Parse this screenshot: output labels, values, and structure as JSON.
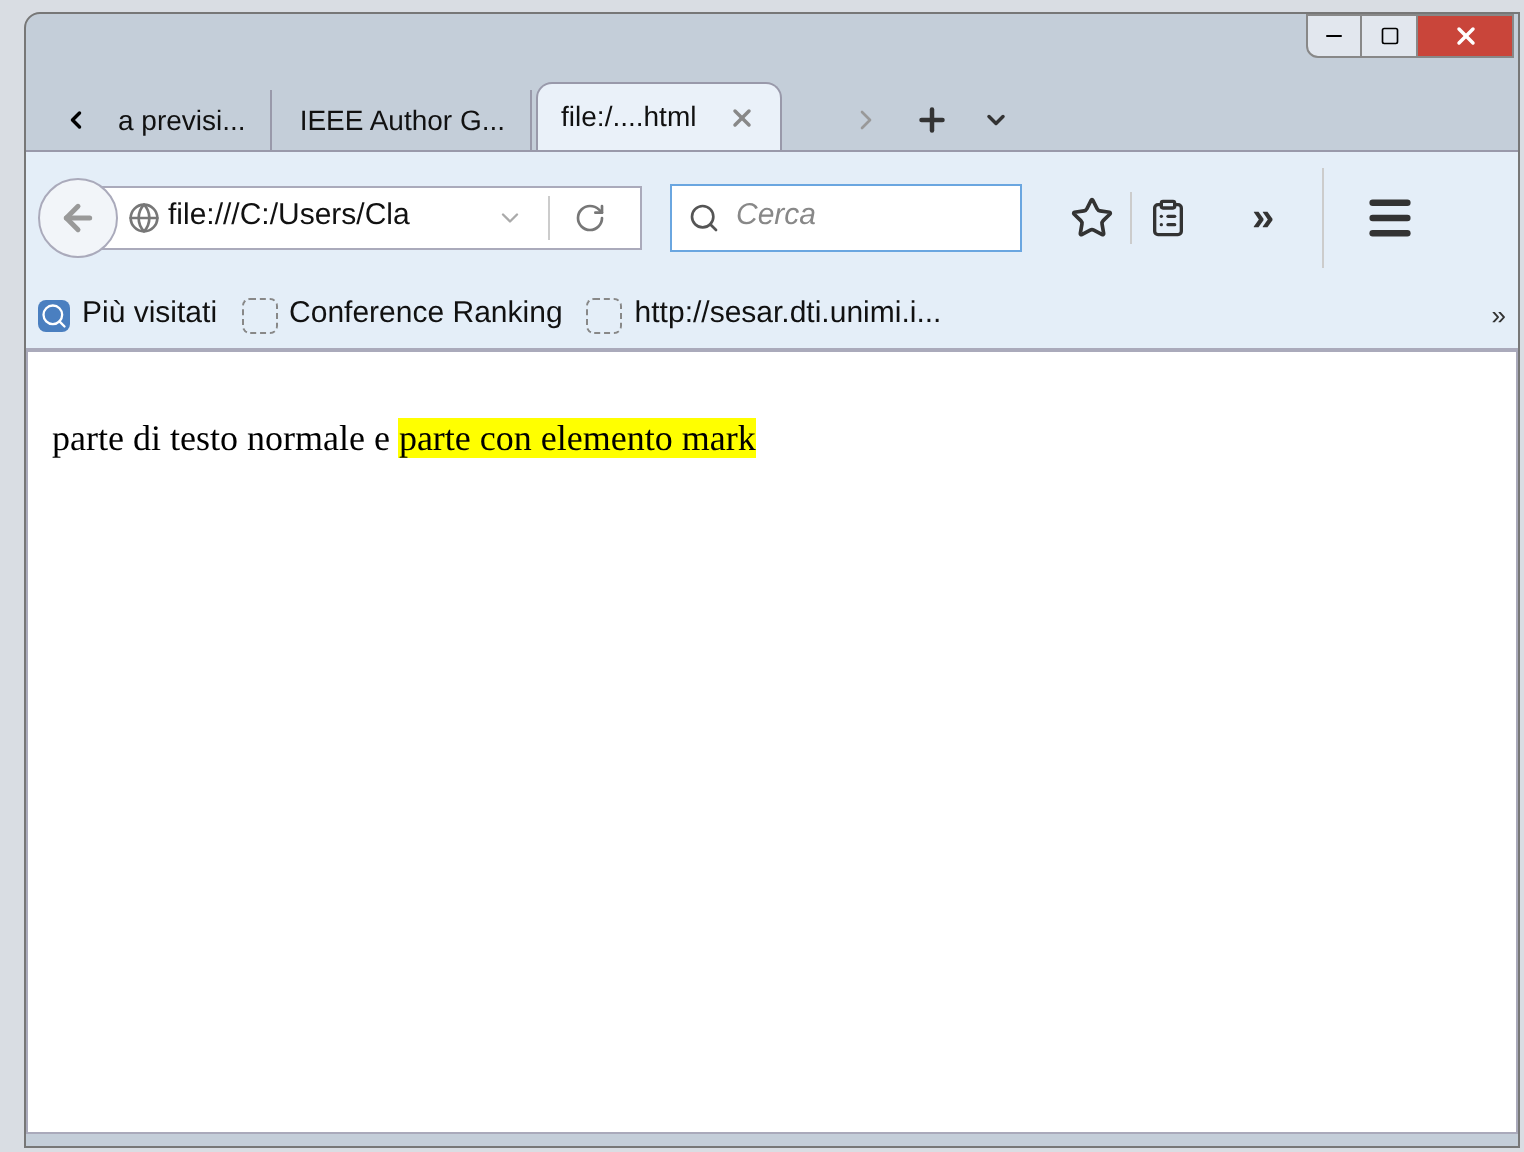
{
  "tabs": [
    {
      "label": "a previsi...",
      "selected": false
    },
    {
      "label": "IEEE Author G...",
      "selected": false
    },
    {
      "label": "file:/....html",
      "selected": true
    }
  ],
  "address_bar": {
    "value": "file:///C:/Users/Cla"
  },
  "search": {
    "placeholder": "Cerca"
  },
  "toolbar_overflow": "»",
  "bookmarks": [
    {
      "label": "Più visitati",
      "kind": "folder"
    },
    {
      "label": "Conference Ranking",
      "kind": "page"
    },
    {
      "label": "http://sesar.dti.unimi.i...",
      "kind": "page"
    }
  ],
  "bookmarks_overflow": "»",
  "content": {
    "segments": [
      {
        "text": "parte di testo normale e ",
        "highlighted": false
      },
      {
        "text": "parte con elemento mark",
        "highlighted": true
      }
    ]
  }
}
